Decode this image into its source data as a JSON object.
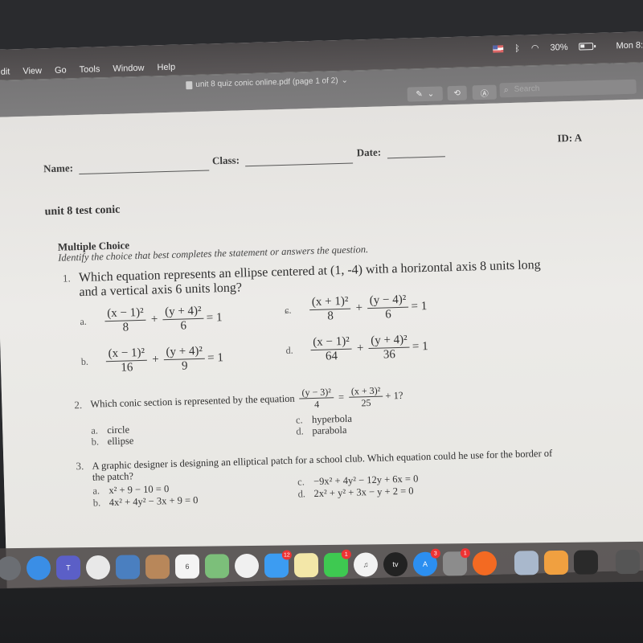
{
  "menubar": {
    "menus": [
      "dit",
      "View",
      "Go",
      "Tools",
      "Window",
      "Help"
    ],
    "battery": "30%",
    "clock": "Mon 8:"
  },
  "toolbar": {
    "document_title": "unit 8 quiz conic online.pdf (page 1 of 2)",
    "search_placeholder": "Search"
  },
  "document": {
    "id": "ID: A",
    "name_label": "Name:",
    "class_label": "Class:",
    "date_label": "Date:",
    "title": "unit 8 test conic",
    "section": "Multiple Choice",
    "instructions": "Identify the choice that best completes the statement or answers the question.",
    "questions": [
      {
        "number": "1.",
        "text": "Which equation represents an ellipse centered at (1, -4) with a horizontal axis 8 units long",
        "text2": "and a vertical axis 6 units long?",
        "options": [
          {
            "label": "a.",
            "n1": "(x − 1)²",
            "d1": "8",
            "n2": "(y + 4)²",
            "d2": "6",
            "rhs": "= 1"
          },
          {
            "label": "b.",
            "n1": "(x − 1)²",
            "d1": "16",
            "n2": "(y + 4)²",
            "d2": "9",
            "rhs": "= 1"
          },
          {
            "label": "ɕ.",
            "n1": "(x + 1)²",
            "d1": "8",
            "n2": "(y − 4)²",
            "d2": "6",
            "rhs": "= 1"
          },
          {
            "label": "d.",
            "n1": "(x − 1)²",
            "d1": "64",
            "n2": "(y + 4)²",
            "d2": "36",
            "rhs": "= 1"
          }
        ]
      },
      {
        "number": "2.",
        "text": "Which conic section is represented by the equation",
        "eq_n1": "(y − 3)²",
        "eq_d1": "4",
        "eq_n2": "(x + 3)²",
        "eq_d2": "25",
        "eq_tail": "+ 1?",
        "options": [
          {
            "label": "a.",
            "text": "circle"
          },
          {
            "label": "b.",
            "text": "ellipse"
          },
          {
            "label": "c.",
            "text": "hyperbola"
          },
          {
            "label": "d.",
            "text": "parabola"
          }
        ]
      },
      {
        "number": "3.",
        "text": "A graphic designer is designing an elliptical patch for a school club. Which equation could he use for the border of",
        "text2": "the patch?",
        "options": [
          {
            "label": "a.",
            "text": "x² + 9 − 10 = 0"
          },
          {
            "label": "b.",
            "text": "4x² + 4y² − 3x + 9 = 0"
          },
          {
            "label": "c.",
            "text": "−9x² + 4y² − 12y + 6x = 0"
          },
          {
            "label": "d.",
            "text": "2x² + y² + 3x − y + 2 = 0"
          }
        ]
      }
    ]
  },
  "dock": {
    "apps": [
      {
        "name": "launchpad",
        "color": "#6b6e73"
      },
      {
        "name": "safari",
        "color": "#3a8ee6"
      },
      {
        "name": "teams",
        "color": "#5b5fc7",
        "glyph": "T"
      },
      {
        "name": "chrome",
        "color": "#e8e8e8"
      },
      {
        "name": "preview",
        "color": "#4a7fc0"
      },
      {
        "name": "contacts",
        "color": "#b8875a"
      },
      {
        "name": "calendar",
        "color": "#f4f4f4",
        "glyph": "6"
      },
      {
        "name": "maps",
        "color": "#7cbf7a"
      },
      {
        "name": "photos",
        "color": "#f0f0f0"
      },
      {
        "name": "messages",
        "color": "#3c9cf2",
        "badge": "12"
      },
      {
        "name": "notes",
        "color": "#f3e7a8"
      },
      {
        "name": "facetime",
        "color": "#3ec951",
        "badge": "1"
      },
      {
        "name": "music",
        "color": "#f2f2f2",
        "glyph": "♫"
      },
      {
        "name": "apple-tv",
        "color": "#222222",
        "glyph": "tv"
      },
      {
        "name": "app-store",
        "color": "#2c8ff0",
        "glyph": "A",
        "badge": "3"
      },
      {
        "name": "system-preferences",
        "color": "#8c8c8c",
        "badge": "1"
      },
      {
        "name": "origin",
        "color": "#f36a22"
      },
      {
        "name": "preview-docs",
        "color": "#a9b8cc"
      },
      {
        "name": "pages",
        "color": "#f0a040"
      },
      {
        "name": "stocks",
        "color": "#2a2a2a"
      },
      {
        "name": "downloads-stack",
        "color": "#555"
      },
      {
        "name": "recent-stack",
        "color": "#444"
      }
    ]
  }
}
